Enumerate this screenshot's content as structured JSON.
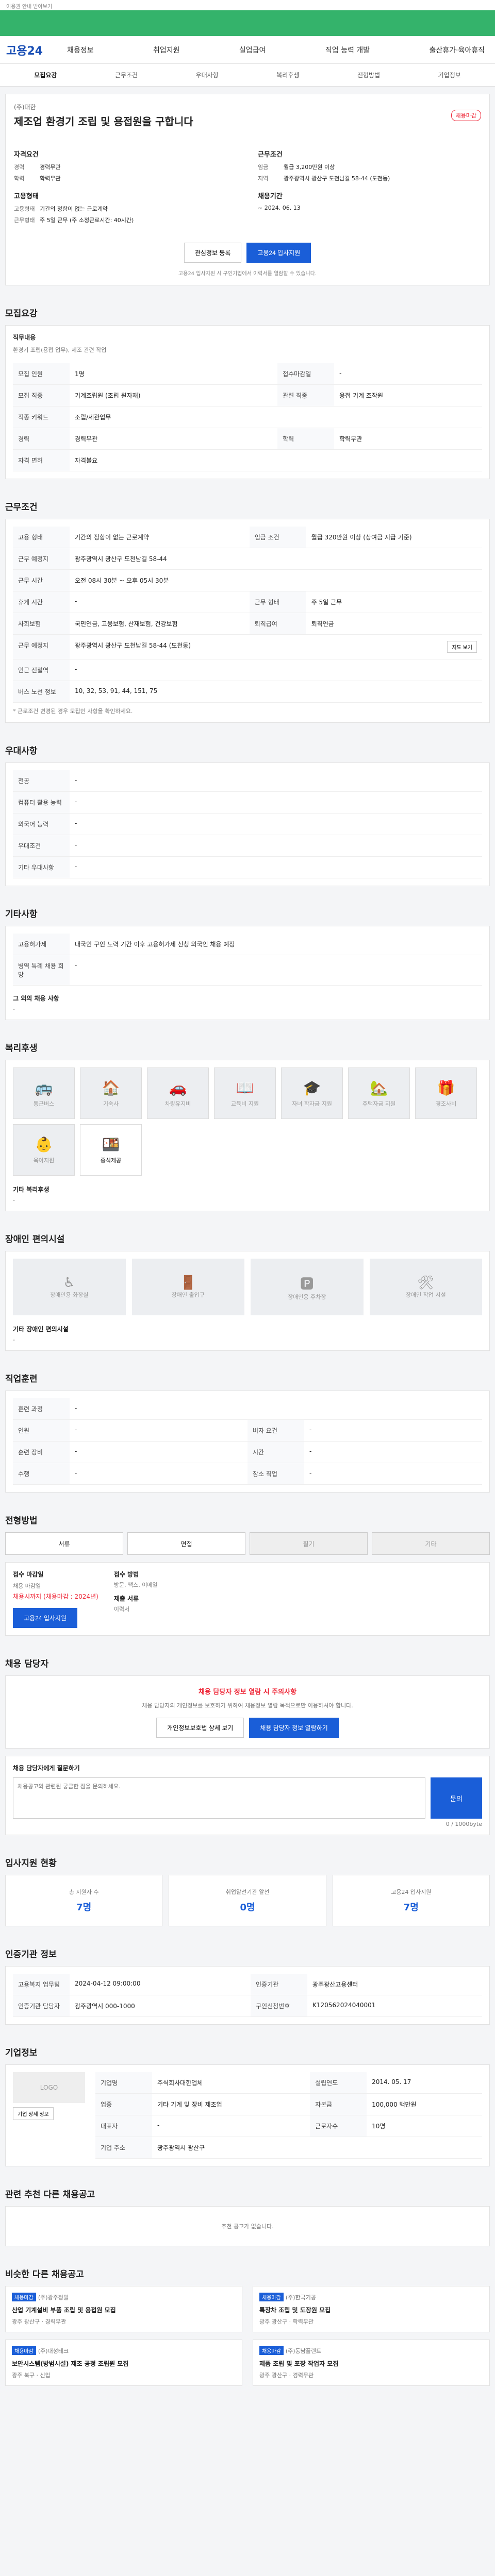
{
  "topbar": "이용권 안내 받아보기",
  "gnb": {
    "logo": "고용24",
    "menu": [
      "채용정보",
      "취업지원",
      "실업급여",
      "직업 능력 개발",
      "출산휴가·육아휴직"
    ]
  },
  "tabs": [
    "모집요강",
    "근무조건",
    "우대사항",
    "복리후생",
    "전형방법",
    "기업정보"
  ],
  "summary": {
    "company": "(주)대한",
    "title": "제조업 환경기 조립 및 용접원을 구합니다",
    "badge": "채용마감",
    "col1_title": "자격요건",
    "col1": [
      [
        "경력",
        "경력무관"
      ],
      [
        "학력",
        "학력무관"
      ]
    ],
    "col1b_title": "고용형태",
    "col1b": [
      [
        "고용형태",
        "기간의 정함이 없는 근로계약"
      ],
      [
        "근무형태",
        "주 5일 근무 (주 소정근로시간: 40시간)"
      ]
    ],
    "col2_title": "근무조건",
    "col2": [
      [
        "임금",
        "월급 3,200만원 이상"
      ],
      [
        "지역",
        "광주광역시 광산구 도천남길 58-44 (도천동)"
      ]
    ],
    "col2b_title": "채용기간",
    "col2b": [
      [
        "",
        "~ 2024. 06. 13"
      ]
    ],
    "btn_fav": "관심정보 등록",
    "btn_apply": "고용24 입사지원",
    "note": "고용24 입사지원 시 구인기업에서 이력서를 열람할 수 있습니다."
  },
  "recruit": {
    "section": "모집요강",
    "job_title_label": "직무내용",
    "job_desc": "환경기 조립(용접 업무), 제조 관련 작업",
    "rows": [
      [
        "모집 인원",
        "1명",
        "접수마감일",
        "-"
      ],
      [
        "모집 직종",
        "기계조립원 (조립 원자재)",
        "관련 직종",
        "용접 기계 조작원"
      ],
      [
        "직종 키워드",
        "조립/제관업무",
        "",
        ""
      ],
      [
        "경력",
        "경력무관",
        "학력",
        "학력무관"
      ],
      [
        "자격 면허",
        "자격불요",
        "",
        ""
      ]
    ]
  },
  "work": {
    "section": "근무조건",
    "rows": [
      [
        "고용 형태",
        "기간의 정함이 없는 근로계약",
        "임금 조건",
        "월급 320만원 이상 (상여금 지급 기준)"
      ],
      [
        "근무 예정지",
        "광주광역시 광산구 도천남길 58-44",
        "",
        ""
      ],
      [
        "근무 시간",
        "오전 08시 30분 ~ 오후 05시 30분",
        "",
        ""
      ],
      [
        "휴게 시간",
        "-",
        "근무 형태",
        "주 5일 근무"
      ],
      [
        "사회보험",
        "국민연금, 고용보험, 산재보험, 건강보험",
        "퇴직급여",
        "퇴직연금"
      ],
      [
        "근무 예정지",
        "광주광역시 광산구 도천남길 58-44 (도천동)",
        "",
        ""
      ],
      [
        "인근 전철역",
        "-",
        "",
        ""
      ],
      [
        "버스 노선 정보",
        "10, 32, 53, 91, 44, 151, 75",
        "",
        ""
      ]
    ],
    "map_button": "지도 보기",
    "note": "* 근로조건 변경된 경우 모집인 사항을 확인하세요."
  },
  "pref": {
    "section": "우대사항",
    "rows": [
      [
        "전공",
        "-"
      ],
      [
        "컴퓨터 활용 능력",
        "-"
      ],
      [
        "외국어 능력",
        "-"
      ],
      [
        "우대조건",
        "-"
      ],
      [
        "기타 우대사항",
        "-"
      ]
    ]
  },
  "etc": {
    "section": "기타사항",
    "rows": [
      [
        "고용허가제",
        "내국인 구인 노력 기간 이후 고용허가제 신청 외국인 채용 예정"
      ],
      [
        "병역 특례 채용 희망",
        "-"
      ]
    ],
    "other_label": "그 외의 채용 사항",
    "other_value": "-"
  },
  "welfare": {
    "section": "복리후생",
    "items": [
      "통근버스",
      "기숙사",
      "차량유지비",
      "교육비 지원",
      "자녀 학자금 지원",
      "주택자금 지원",
      "경조사비",
      "육아지원",
      "중식제공"
    ],
    "etc_label": "기타 복리후생",
    "etc_value": "-"
  },
  "disabled": {
    "section": "장애인 편의시설",
    "items": [
      "장애인용 화장실",
      "장애인 출입구",
      "장애인용 주차장",
      "장애인 작업 시설"
    ],
    "etc_label": "기타 장애인 편의시설",
    "etc_value": "-"
  },
  "screening": {
    "section": "직업훈련",
    "rows": [
      [
        "훈련 과정",
        "-",
        "",
        ""
      ],
      [
        "인원",
        "-",
        "비자 요건",
        "-"
      ],
      [
        "훈련 장비",
        "-",
        "시간",
        "-"
      ],
      [
        "수행",
        "-",
        "장소 직업",
        "-"
      ]
    ]
  },
  "method": {
    "section": "전형방법",
    "items": [
      "서류",
      "면접",
      "필기",
      "기타"
    ]
  },
  "apply": {
    "section": "접수 마감일",
    "deadline_label": "채용 마감일",
    "deadline": "채용시까지 (채용마감 : 2024년)",
    "method_label": "접수 방법",
    "method": "방문, 팩스, 이메일",
    "docs_label": "제출 서류",
    "docs": "이력서",
    "apply_button": "고용24 입사지원"
  },
  "contact": {
    "section": "채용 담당자",
    "warn": "채용 담당자 정보 열람 시 주의사항",
    "warn_text": "채용 담당자의 개인정보를 보호하기 위하여 채용정보 열람 목적으로만 이용하셔야 합니다.",
    "btn1": "개인정보보호법 상세 보기",
    "btn2": "채용 담당자 정보 열람하기"
  },
  "qa": {
    "section": "채용 담당자에게 질문하기",
    "placeholder": "채용공고와 관련된 궁금한 점을 문의하세요.",
    "counter": "0 / 1000byte",
    "button": "문의"
  },
  "stats": {
    "section": "입사지원 현황",
    "items": [
      [
        "총 지원자 수",
        "7명"
      ],
      [
        "취업알선기관 알선",
        "0명"
      ],
      [
        "고용24 입사지원",
        "7명"
      ]
    ]
  },
  "agency": {
    "section": "인증기관 정보",
    "rows": [
      [
        "고용복지 업무팀",
        "2024-04-12 09:00:00",
        "인증기관",
        "광주광산고용센터"
      ],
      [
        "인증기관 담당자",
        "광주광역시 000-1000",
        "구인신청번호",
        "K120562024040001"
      ]
    ]
  },
  "company": {
    "section": "기업정보",
    "logo": "LOGO",
    "rows": [
      [
        "기업명",
        "주식회사대한업체",
        "설립연도",
        "2014. 05. 17"
      ],
      [
        "업종",
        "기타 기계 및 장비 제조업",
        "자본금",
        "100,000 백만원"
      ],
      [
        "대표자",
        "-",
        "근로자수",
        "10명"
      ],
      [
        "기업 주소",
        "광주광역시 광산구",
        "",
        ""
      ]
    ],
    "btn": "기업 상세 정보"
  },
  "same": {
    "section": "관련 추천 다른 채용공고",
    "empty": "추천 공고가 없습니다."
  },
  "similar": {
    "section": "비슷한 다른 채용공고",
    "items": [
      {
        "tag": "채용마감",
        "company": "(주)광주정밀",
        "title": "산업 기계설비 부품 조립 및 용접원 모집",
        "meta": "광주 광산구 · 경력무관"
      },
      {
        "tag": "채용마감",
        "company": "(주)한국기공",
        "title": "특장차 조립 및 도장원 모집",
        "meta": "광주 광산구 · 학력무관"
      },
      {
        "tag": "채용마감",
        "company": "(주)대성테크",
        "title": "보안시스템(방범시설) 제조 공정 조립원 모집",
        "meta": "광주 북구 · 신입"
      },
      {
        "tag": "채용마감",
        "company": "(주)동남플랜트",
        "title": "제품 조립 및 포장 작업자 모집",
        "meta": "광주 광산구 · 경력무관"
      }
    ]
  }
}
